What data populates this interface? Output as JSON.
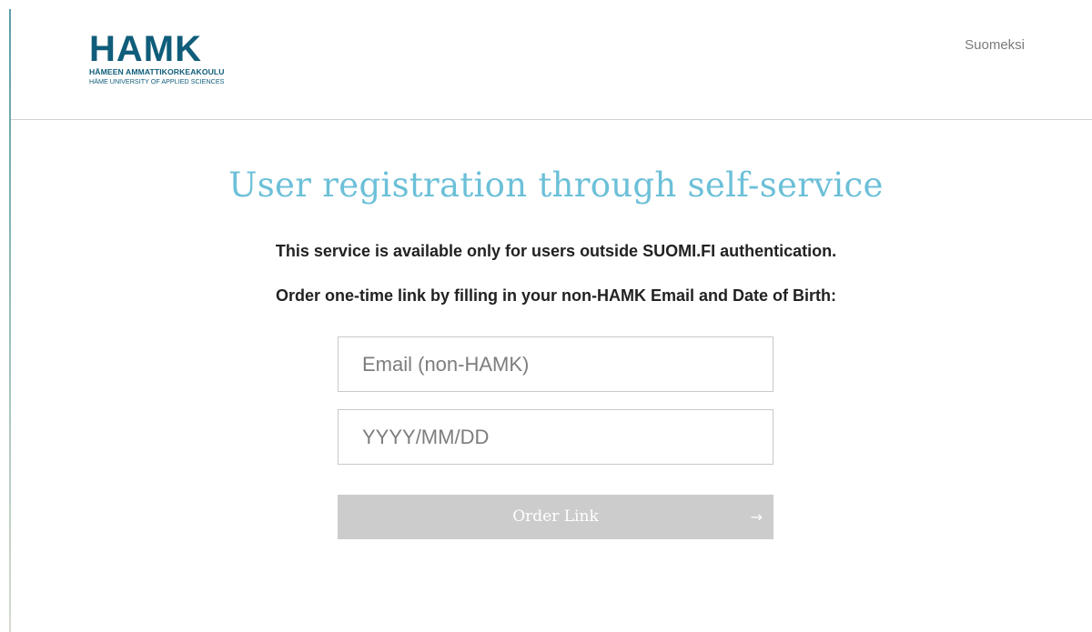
{
  "header": {
    "logo": {
      "wordmark": "HAMK",
      "line1": "HÄMEEN AMMATTIKORKEAKOULU",
      "line2": "HÄME UNIVERSITY OF APPLIED SCIENCES"
    },
    "language_link": "Suomeksi"
  },
  "main": {
    "title": "User registration through self-service",
    "notice": "This service is available only for users outside SUOMI.FI authentication.",
    "instruction": "Order one-time link by filling in your non-HAMK Email and Date of Birth:",
    "form": {
      "email": {
        "value": "",
        "placeholder": "Email (non-HAMK)"
      },
      "date_of_birth": {
        "value": "",
        "placeholder": "YYYY/MM/DD"
      },
      "submit": {
        "label": "Order Link",
        "icon": "arrow-right-icon",
        "enabled": false
      }
    }
  },
  "colors": {
    "brand": "#0f5d7a",
    "title": "#6cc0d8",
    "button_disabled": "#cccccc"
  }
}
